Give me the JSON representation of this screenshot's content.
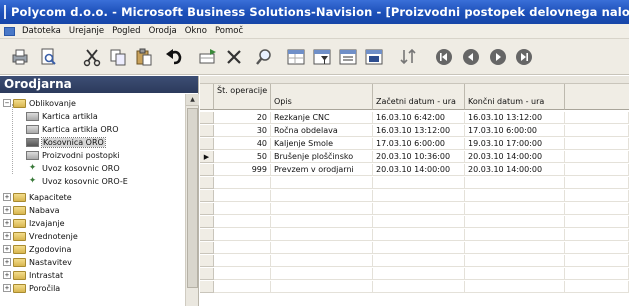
{
  "window": {
    "title": "Polycom d.o.o. - Microsoft Business Solutions-Navision - [Proizvodni postopek delovnega naloga]"
  },
  "menu": [
    "Datoteka",
    "Urejanje",
    "Pogled",
    "Orodja",
    "Okno",
    "Pomoč"
  ],
  "toolbar": [
    "print-icon",
    "print-preview-icon",
    "cut-icon",
    "copy-icon",
    "paste-icon",
    "undo-icon",
    "insert-icon",
    "delete-icon",
    "find-icon",
    "filter-icon",
    "field-filter-icon",
    "flowfilter-icon",
    "show-all-icon",
    "sort-icon",
    "first-record-icon",
    "previous-record-icon",
    "next-record-icon",
    "last-record-icon"
  ],
  "sidebar": {
    "header": "Orodjarna",
    "items": [
      {
        "label": "Oblikovanje",
        "expander": "−",
        "icon": "folder-icon",
        "level": 0
      },
      {
        "label": "Kartica artikla",
        "icon": "card-icon",
        "level": 2
      },
      {
        "label": "Kartica artikla ORO",
        "icon": "card-icon",
        "level": 2
      },
      {
        "label": "Kosovnica ORO",
        "icon": "card-icon",
        "level": 2,
        "selected": true
      },
      {
        "label": "Proizvodni postopki",
        "icon": "card-icon",
        "level": 2
      },
      {
        "label": "Uvoz kosovnic ORO",
        "icon": "star-icon",
        "level": 2
      },
      {
        "label": "Uvoz kosovnic ORO-E",
        "icon": "star-icon",
        "level": 2
      },
      {
        "label": "Kapacitete",
        "expander": "+",
        "icon": "folder-icon",
        "level": 0
      },
      {
        "label": "Nabava",
        "expander": "+",
        "icon": "folder-icon",
        "level": 0
      },
      {
        "label": "Izvajanje",
        "expander": "+",
        "icon": "folder-icon",
        "level": 0
      },
      {
        "label": "Vrednotenje",
        "expander": "+",
        "icon": "folder-icon",
        "level": 0
      },
      {
        "label": "Zgodovina",
        "expander": "+",
        "icon": "folder-icon",
        "level": 0
      },
      {
        "label": "Nastavitev",
        "expander": "+",
        "icon": "folder-icon",
        "level": 0
      },
      {
        "label": "Intrastat",
        "expander": "+",
        "icon": "folder-icon",
        "level": 0
      },
      {
        "label": "Poročila",
        "expander": "+",
        "icon": "folder-icon",
        "level": 0
      }
    ]
  },
  "table": {
    "columns": [
      "Št. operacije",
      "Opis",
      "Začetni datum - ura",
      "Končni datum - ura"
    ],
    "rows": [
      [
        "20",
        "Rezkanje CNC",
        "16.03.10 6:42:00",
        "16.03.10 13:12:00"
      ],
      [
        "30",
        "Ročna obdelava",
        "16.03.10 13:12:00",
        "17.03.10 6:00:00"
      ],
      [
        "40",
        "Kaljenje Smole",
        "17.03.10 6:00:00",
        "19.03.10 17:00:00"
      ],
      [
        "50",
        "Brušenje ploščinsko",
        "20.03.10 10:36:00",
        "20.03.10 14:00:00"
      ],
      [
        "999",
        "Prevzem v orodjarni",
        "20.03.10 14:00:00",
        "20.03.10 14:00:00"
      ]
    ],
    "current_row_marker": "▶",
    "current_row_index": 3
  }
}
